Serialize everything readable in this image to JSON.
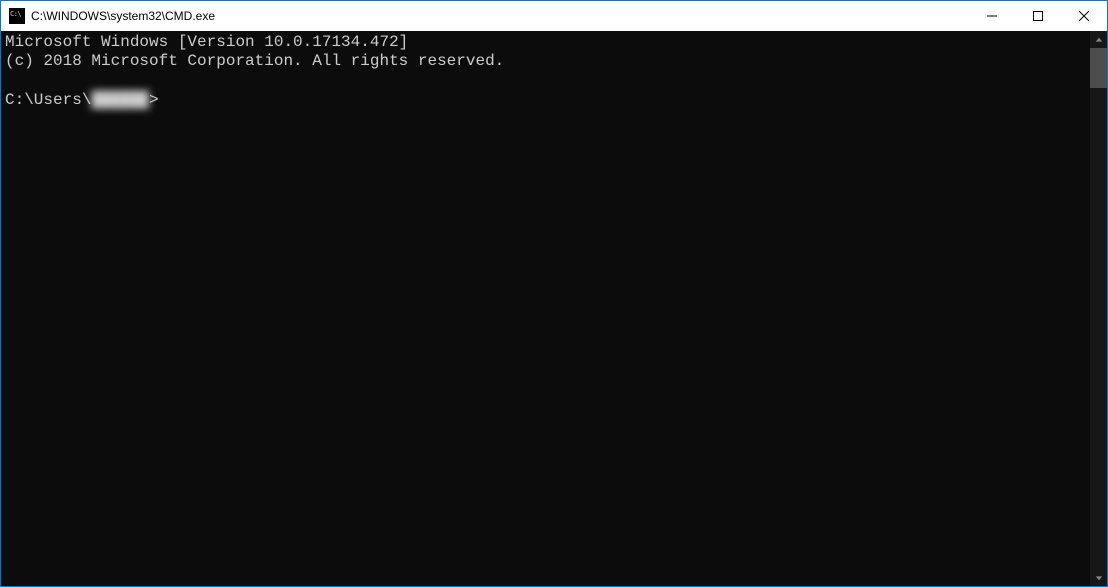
{
  "window": {
    "title": "C:\\WINDOWS\\system32\\CMD.exe"
  },
  "terminal": {
    "line1": "Microsoft Windows [Version 10.0.17134.472]",
    "line2": "(c) 2018 Microsoft Corporation. All rights reserved.",
    "prompt_prefix": "C:\\Users\\",
    "prompt_user": "██████",
    "prompt_suffix": ">"
  }
}
